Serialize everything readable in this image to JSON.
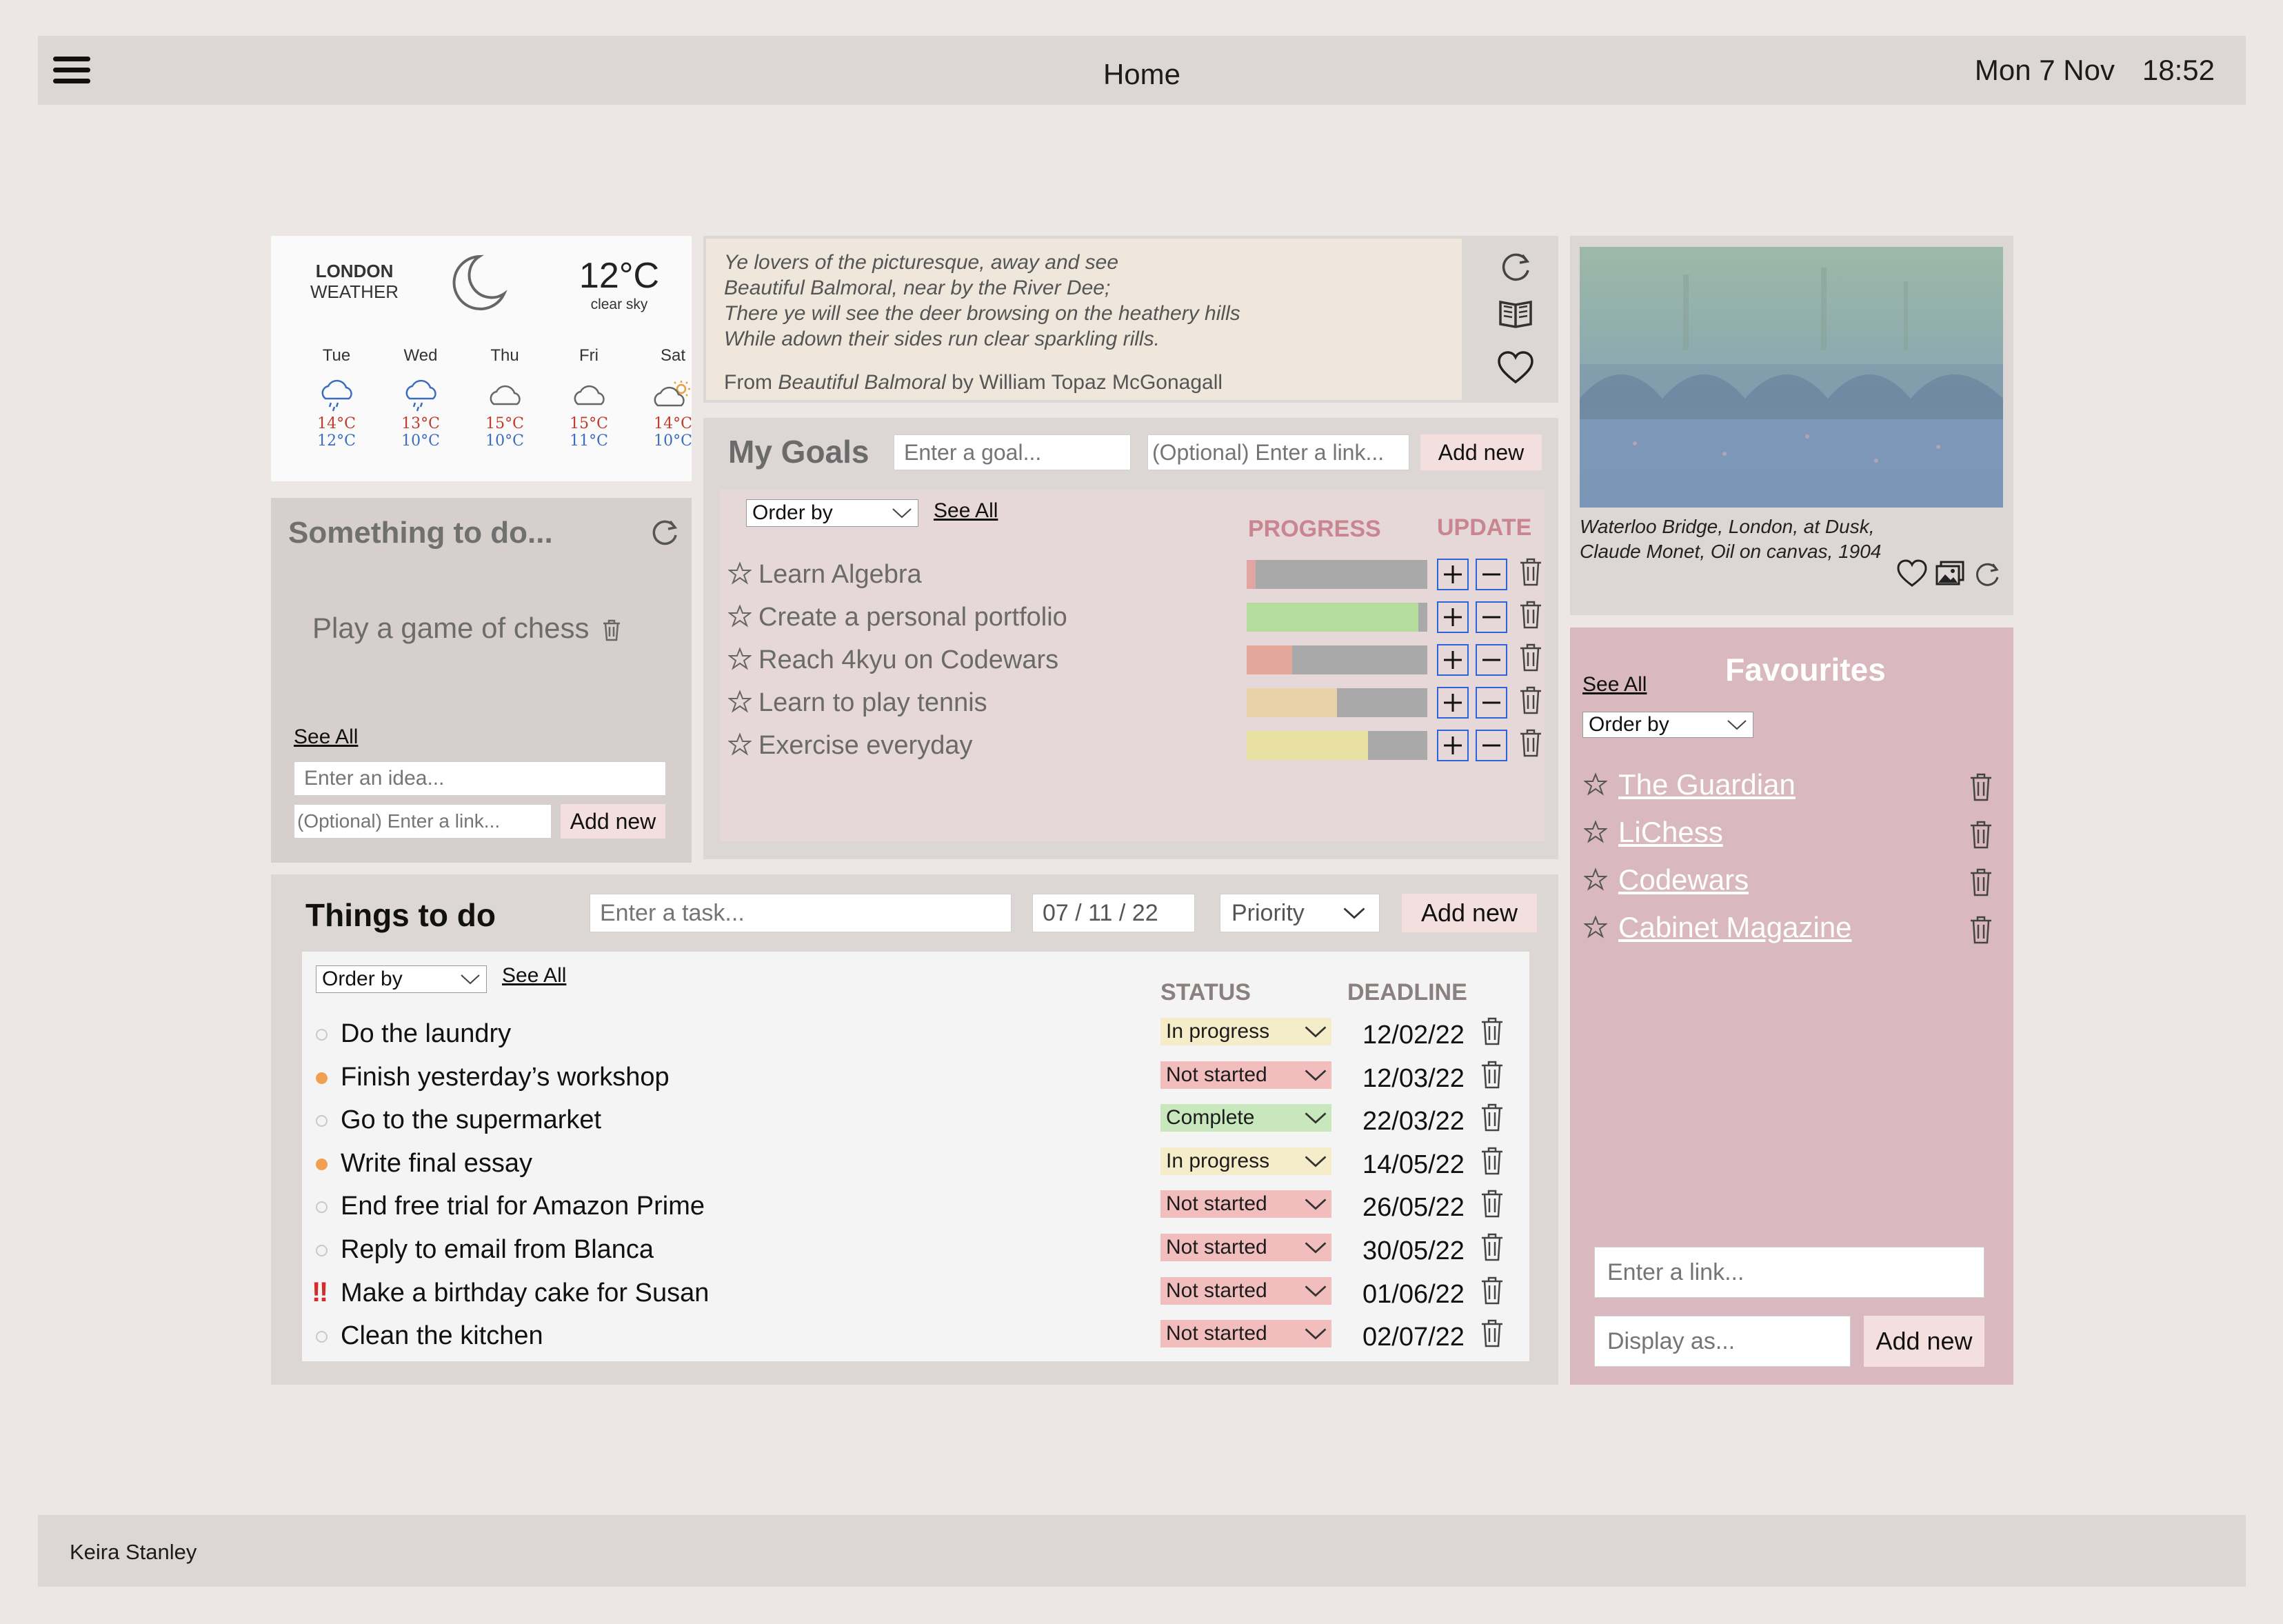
{
  "header": {
    "title": "Home",
    "date": "Mon 7 Nov",
    "time": "18:52"
  },
  "footer": {
    "user": "Keira Stanley"
  },
  "weather": {
    "city": "LONDON",
    "label": "WEATHER",
    "current_temp": "12°C",
    "condition": "clear sky",
    "current_icon": "moon-icon",
    "forecast": [
      {
        "day": "Tue",
        "icon": "rain-cloud-icon",
        "high": "14°C",
        "low": "12°C"
      },
      {
        "day": "Wed",
        "icon": "rain-cloud-icon",
        "high": "13°C",
        "low": "10°C"
      },
      {
        "day": "Thu",
        "icon": "cloud-icon",
        "high": "15°C",
        "low": "10°C"
      },
      {
        "day": "Fri",
        "icon": "cloud-icon",
        "high": "15°C",
        "low": "11°C"
      },
      {
        "day": "Sat",
        "icon": "sun-cloud-icon",
        "high": "14°C",
        "low": "10°C"
      }
    ]
  },
  "quote": {
    "lines": [
      "Ye lovers of the picturesque, away and see",
      "Beautiful Balmoral, near by the River Dee;",
      "There ye will see the deer browsing on the heathery hills",
      "While adown their sides run clear sparkling rills."
    ],
    "source_prefix": "From ",
    "source_title": "Beautiful Balmoral",
    "source_author": " by William Topaz McGonagall"
  },
  "painting": {
    "caption_line1": "Waterloo Bridge, London, at Dusk,",
    "caption_line2": "Claude Monet, Oil on canvas, 1904"
  },
  "idea": {
    "title": "Something to do...",
    "item": "Play a game of chess",
    "see_all": "See All",
    "idea_placeholder": "Enter an idea...",
    "link_placeholder": "(Optional) Enter a link...",
    "add_label": "Add new"
  },
  "goals": {
    "title": "My Goals",
    "goal_placeholder": "Enter a goal...",
    "link_placeholder": "(Optional) Enter a link...",
    "add_label": "Add new",
    "order_by": "Order by",
    "see_all": "See All",
    "col_progress": "PROGRESS",
    "col_update": "UPDATE",
    "items": [
      {
        "name": "Learn Algebra",
        "progress": 0.05,
        "color": "#e3a4a4"
      },
      {
        "name": "Create a personal portfolio",
        "progress": 0.95,
        "color": "#b5dc9c"
      },
      {
        "name": "Reach 4kyu on Codewars",
        "progress": 0.25,
        "color": "#e3a89a"
      },
      {
        "name": "Learn to play tennis",
        "progress": 0.5,
        "color": "#e8d2a8"
      },
      {
        "name": "Exercise everyday",
        "progress": 0.67,
        "color": "#e8e1a2"
      }
    ]
  },
  "todo": {
    "title": "Things to do",
    "task_placeholder": "Enter a task...",
    "date_value": "07 / 11 / 22",
    "priority": "Priority",
    "add_label": "Add new",
    "order_by": "Order by",
    "see_all": "See All",
    "col_status": "STATUS",
    "col_deadline": "DEADLINE",
    "tasks": [
      {
        "name": "Do the laundry",
        "marker": "none",
        "status": "In progress",
        "status_color": "#f5edc9",
        "deadline": "12/02/22"
      },
      {
        "name": "Finish yesterday’s workshop",
        "marker": "orange",
        "status": "Not started",
        "status_color": "#f2bdbd",
        "deadline": "12/03/22"
      },
      {
        "name": "Go to the supermarket",
        "marker": "none",
        "status": "Complete",
        "status_color": "#c9e7bd",
        "deadline": "22/03/22"
      },
      {
        "name": "Write final essay",
        "marker": "orange",
        "status": "In progress",
        "status_color": "#f5edc9",
        "deadline": "14/05/22"
      },
      {
        "name": "End free trial for Amazon Prime",
        "marker": "none",
        "status": "Not started",
        "status_color": "#f2bdbd",
        "deadline": "26/05/22"
      },
      {
        "name": "Reply to email from Blanca",
        "marker": "none",
        "status": "Not started",
        "status_color": "#f2bdbd",
        "deadline": "30/05/22"
      },
      {
        "name": "Make a birthday cake for Susan",
        "marker": "urgent",
        "status": "Not started",
        "status_color": "#f2bdbd",
        "deadline": "01/06/22"
      },
      {
        "name": "Clean the kitchen",
        "marker": "none",
        "status": "Not started",
        "status_color": "#f2bdbd",
        "deadline": "02/07/22"
      }
    ]
  },
  "favourites": {
    "title": "Favourites",
    "see_all": "See All",
    "order_by": "Order by",
    "items": [
      "The Guardian",
      "LiChess",
      "Codewars",
      "Cabinet Magazine"
    ],
    "link_placeholder": "Enter a link...",
    "display_placeholder": "Display as...",
    "add_label": "Add new"
  },
  "colors": {
    "accent_blue": "#2b63d9",
    "favourites_bg": "#d9b9bf",
    "goals_header": "#c98590",
    "urgent_marker": "#d62b2b",
    "orange_marker": "#f0a050"
  }
}
